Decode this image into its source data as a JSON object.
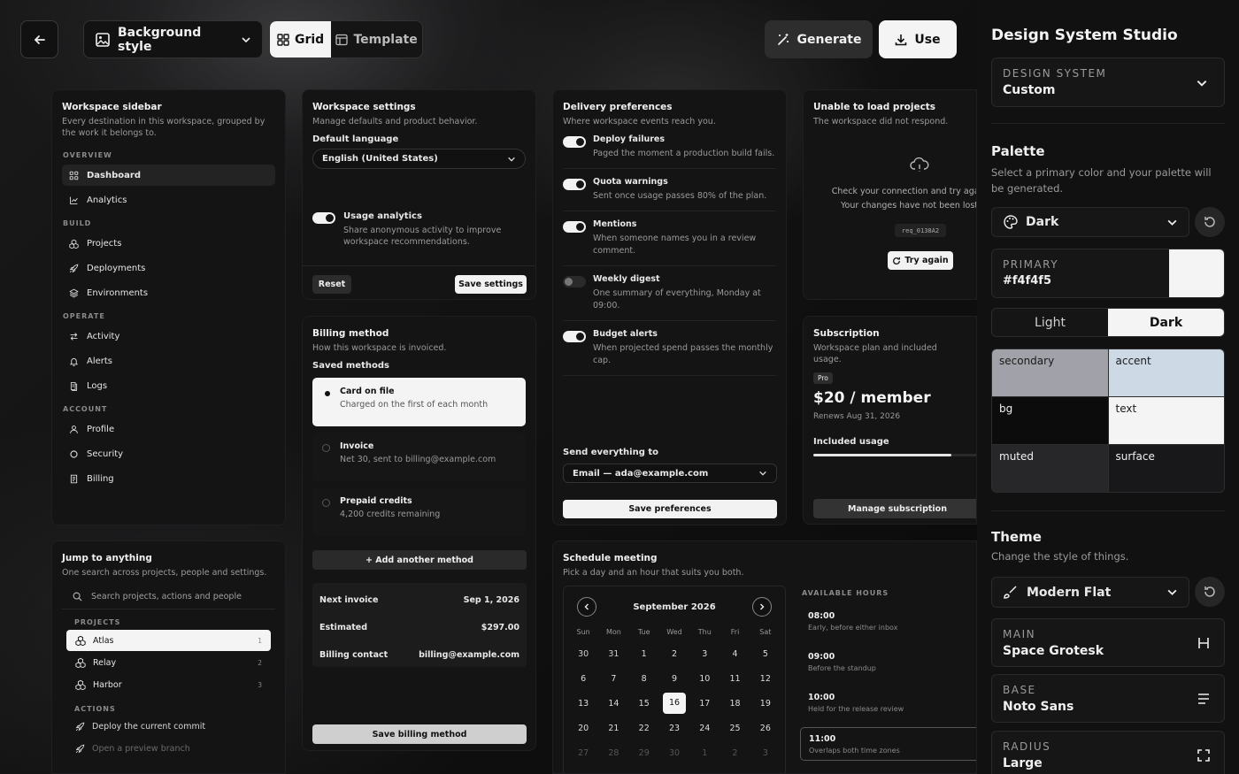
{
  "topbar": {
    "background_style_label": "Background style",
    "view_grid_label": "Grid",
    "view_template_label": "Template",
    "generate_label": "Generate",
    "use_label": "Use"
  },
  "sidebar_card": {
    "title": "Workspace sidebar",
    "subtitle": "Every destination in this workspace, grouped by the work it belongs to.",
    "sections": [
      {
        "label": "OVERVIEW",
        "items": [
          {
            "label": "Dashboard",
            "icon": "grid-icon"
          },
          {
            "label": "Analytics",
            "icon": "chart-icon"
          }
        ]
      },
      {
        "label": "BUILD",
        "items": [
          {
            "label": "Projects",
            "icon": "cubes-icon"
          },
          {
            "label": "Deployments",
            "icon": "rocket-icon"
          },
          {
            "label": "Environments",
            "icon": "layers-icon"
          }
        ]
      },
      {
        "label": "OPERATE",
        "items": [
          {
            "label": "Activity",
            "icon": "arrows-icon"
          },
          {
            "label": "Alerts",
            "icon": "bell-icon"
          },
          {
            "label": "Logs",
            "icon": "logs-icon"
          }
        ]
      },
      {
        "label": "ACCOUNT",
        "items": [
          {
            "label": "Profile",
            "icon": "user-icon"
          },
          {
            "label": "Security",
            "icon": "shield-icon"
          },
          {
            "label": "Billing",
            "icon": "receipt-icon"
          }
        ]
      }
    ]
  },
  "jump_card": {
    "title": "Jump to anything",
    "subtitle": "One search across projects, people and settings.",
    "search_placeholder": "Search projects, actions and people",
    "projects_label": "PROJECTS",
    "projects": [
      {
        "name": "Atlas",
        "key": "1"
      },
      {
        "name": "Relay",
        "key": "2"
      },
      {
        "name": "Harbor",
        "key": "3"
      }
    ],
    "actions_label": "ACTIONS",
    "actions": [
      "Deploy the current commit",
      "Open a preview branch"
    ]
  },
  "settings_card": {
    "title": "Workspace settings",
    "subtitle": "Manage defaults and product behavior.",
    "language_label": "Default language",
    "language_value": "English (United States)",
    "analytics_label": "Usage analytics",
    "analytics_desc": "Share anonymous activity to improve workspace recommendations.",
    "reset_label": "Reset",
    "save_label": "Save settings"
  },
  "billing_card": {
    "title": "Billing method",
    "subtitle": "How this workspace is invoiced.",
    "saved_label": "Saved methods",
    "methods": [
      {
        "title": "Card on file",
        "desc": "Charged on the first of each month"
      },
      {
        "title": "Invoice",
        "desc": "Net 30, sent to billing@example.com"
      },
      {
        "title": "Prepaid credits",
        "desc": "4,200 credits remaining"
      }
    ],
    "add_label": "+ Add another method",
    "summary": [
      {
        "label": "Next invoice",
        "value": "Sep 1, 2026"
      },
      {
        "label": "Estimated",
        "value": "$297.00"
      },
      {
        "label": "Billing contact",
        "value": "billing@example.com"
      }
    ],
    "save_label": "Save billing method"
  },
  "delivery_card": {
    "title": "Delivery preferences",
    "subtitle": "Where workspace events reach you.",
    "prefs": [
      {
        "title": "Deploy failures",
        "desc": "Paged the moment a production build fails.",
        "on": true
      },
      {
        "title": "Quota warnings",
        "desc": "Sent once usage passes 80% of the plan.",
        "on": true
      },
      {
        "title": "Mentions",
        "desc": "When someone names you in a review comment.",
        "on": true
      },
      {
        "title": "Weekly digest",
        "desc": "One summary of everything, Monday at 09:00.",
        "on": false
      },
      {
        "title": "Budget alerts",
        "desc": "When projected spend passes the monthly cap.",
        "on": true
      }
    ],
    "send_label": "Send everything to",
    "send_value": "Email — ada@example.com",
    "save_label": "Save preferences"
  },
  "error_card": {
    "title": "Unable to load projects",
    "subtitle": "The workspace did not respond.",
    "message": "Check your connection and try again. Your changes have not been lost.",
    "code": "req_0138A2",
    "retry_label": "Try again"
  },
  "subscription_card": {
    "title": "Subscription",
    "subtitle": "Workspace plan and included usage.",
    "badge": "Pro",
    "price": "$20 / member",
    "renews": "Renews Aug 31, 2026",
    "usage_label": "Included usage",
    "usage_fraction": 0.82,
    "manage_label": "Manage subscription"
  },
  "schedule_card": {
    "title": "Schedule meeting",
    "subtitle": "Pick a day and an hour that suits you both.",
    "month": "September 2026",
    "weekdays": [
      "Sun",
      "Mon",
      "Tue",
      "Wed",
      "Thu",
      "Fri",
      "Sat"
    ],
    "weeks": [
      [
        "30",
        "31",
        "1",
        "2",
        "3",
        "4",
        "5"
      ],
      [
        "6",
        "7",
        "8",
        "9",
        "10",
        "11",
        "12"
      ],
      [
        "13",
        "14",
        "15",
        "16",
        "17",
        "18",
        "19"
      ],
      [
        "20",
        "21",
        "22",
        "23",
        "24",
        "25",
        "26"
      ],
      [
        "27",
        "28",
        "29",
        "30",
        "1",
        "2",
        "3"
      ]
    ],
    "selected_day": "16",
    "hours_label": "AVAILABLE HOURS",
    "hours": [
      {
        "time": "08:00",
        "desc": "Early, before either inbox"
      },
      {
        "time": "09:00",
        "desc": "Before the standup"
      },
      {
        "time": "10:00",
        "desc": "Held for the release review"
      },
      {
        "time": "11:00",
        "desc": "Overlaps both time zones"
      }
    ]
  },
  "right_panel": {
    "title": "Design System Studio",
    "design_system_label": "DESIGN SYSTEM",
    "design_system_value": "Custom",
    "palette_title": "Palette",
    "palette_desc": "Select a primary color and your palette will be generated.",
    "palette_mode": "Dark",
    "primary_label": "PRIMARY",
    "primary_value": "#f4f4f5",
    "light_label": "Light",
    "dark_label": "Dark",
    "swatches": [
      {
        "name": "secondary",
        "color": "#a1a1aa",
        "text": "#1a1a1a"
      },
      {
        "name": "accent",
        "color": "#cdd9e5",
        "text": "#1a1a1a"
      },
      {
        "name": "bg",
        "color": "#0c0c0d",
        "text": "#f0f0f0"
      },
      {
        "name": "text",
        "color": "#f4f4f5",
        "text": "#1a1a1a"
      },
      {
        "name": "muted",
        "color": "#27272a",
        "text": "#f0f0f0"
      },
      {
        "name": "surface",
        "color": "#18181b",
        "text": "#f0f0f0"
      }
    ],
    "theme_title": "Theme",
    "theme_desc": "Change the style of things.",
    "theme_value": "Modern Flat",
    "main_font_label": "MAIN",
    "main_font_value": "Space Grotesk",
    "base_font_label": "BASE",
    "base_font_value": "Noto Sans",
    "radius_label": "RADIUS",
    "radius_value": "Large"
  }
}
